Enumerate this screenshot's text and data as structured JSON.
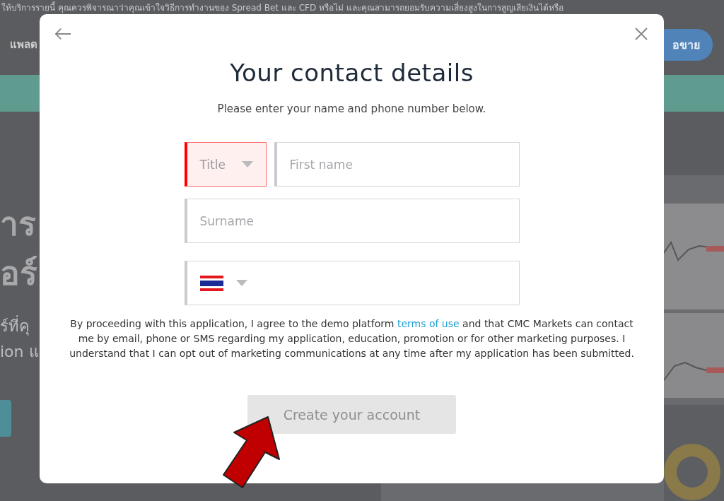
{
  "background": {
    "banner": "ให้บริการรายนี้ คุณควรพิจารณาว่าคุณเข้าใจวิธีการทำงานของ Spread Bet และ CFD หรือไม่ และคุณสามารถยอมรับความเสี่ยงสูงในการสูญเสียเงินได้หรือ",
    "nav_item": "แพลต",
    "nav_button": "อขาย",
    "headline": [
      "าร",
      "อร์"
    ],
    "subtext": [
      "ร์ที่คุ",
      "ion แ"
    ]
  },
  "modal": {
    "title": "Your contact details",
    "subtitle": "Please enter your name and phone number below.",
    "field_rows": [
      [
        {
          "kind": "select",
          "placeholder": "Title",
          "invalid": true
        },
        {
          "kind": "text",
          "placeholder": "First name",
          "invalid": false
        }
      ],
      [
        {
          "kind": "text",
          "placeholder": "Surname",
          "invalid": false
        }
      ],
      [
        {
          "kind": "phone",
          "invalid": false
        }
      ]
    ],
    "consent_before": "By proceeding with this application, I agree to the demo platform",
    "consent_link": "terms of use",
    "consent_after": "and that CMC Markets can contact me by email, phone or SMS regarding my application, education, promotion or for other marketing purposes. I understand that I can opt out of marketing communications at any time after my application has been submitted.",
    "submit": {
      "label": "Create your account",
      "disabled": true
    }
  },
  "annotation": {
    "kind": "arrow"
  }
}
